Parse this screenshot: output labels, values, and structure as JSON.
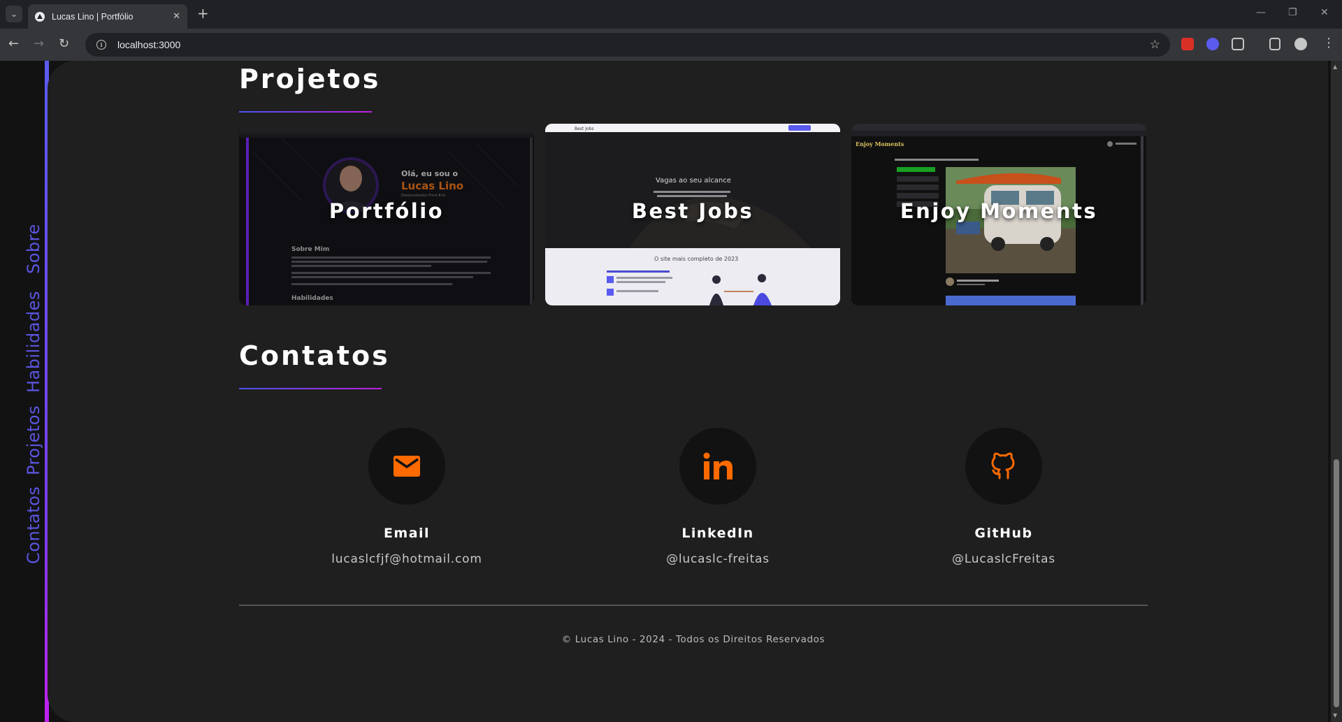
{
  "browser": {
    "tab_title": "Lucas Lino | Portfólio",
    "url": "localhost:3000",
    "icons": [
      "chevron-down-icon",
      "close-icon",
      "plus-icon",
      "back-icon",
      "forward-icon",
      "reload-icon",
      "info-icon",
      "star-icon",
      "extension-icon",
      "profile-icon",
      "menu-icon"
    ]
  },
  "sidebar": {
    "items": [
      {
        "label": "Sobre"
      },
      {
        "label": "Habilidades"
      },
      {
        "label": "Projetos"
      },
      {
        "label": "Contatos"
      }
    ],
    "accent": "#5b55e0"
  },
  "projects": {
    "title": "Projetos",
    "items": [
      {
        "name": "Portfólio",
        "preview": {
          "greeting": "Olá, eu sou o",
          "highlight": "Lucas Lino",
          "role": "Desenvolvedor Front-End",
          "heading": "Sobre Mim",
          "heading2": "Habilidades"
        }
      },
      {
        "name": "Best Jobs",
        "preview": {
          "brand": "Best Jobs",
          "tagline": "Vagas ao seu alcance",
          "subtitle": "O site mais completo de 2023"
        }
      },
      {
        "name": "Enjoy Moments",
        "preview": {
          "brand": "Enjoy Moments"
        }
      }
    ]
  },
  "contacts": {
    "title": "Contatos",
    "items": [
      {
        "label": "Email",
        "value": "lucaslcfjf@hotmail.com",
        "icon": "mail-icon"
      },
      {
        "label": "LinkedIn",
        "value": "@lucaslc-freitas",
        "icon": "linkedin-icon"
      },
      {
        "label": "GitHub",
        "value": "@LucaslcFreitas",
        "icon": "github-icon"
      }
    ],
    "icon_color": "#ff6a00"
  },
  "footer": {
    "text": "© Lucas Lino - 2024 - Todos os Direitos Reservados"
  }
}
